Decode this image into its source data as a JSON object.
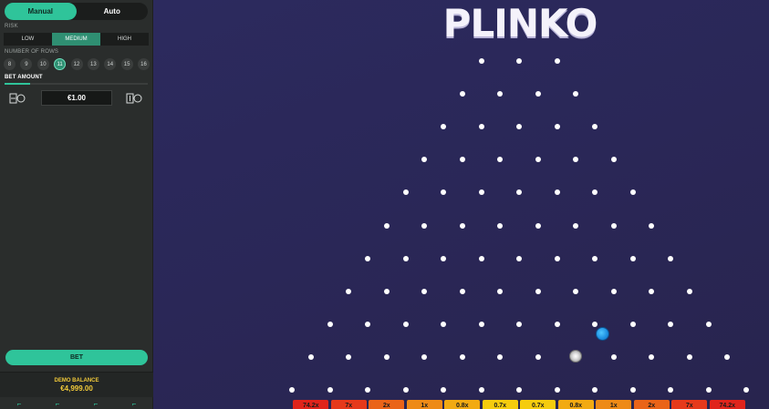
{
  "game": {
    "title": "PLINKO"
  },
  "panel": {
    "modes": {
      "manual": "Manual",
      "auto": "Auto"
    },
    "risk": {
      "label": "RISK",
      "options": [
        "LOW",
        "MEDIUM",
        "HIGH"
      ],
      "selected": "MEDIUM"
    },
    "rows": {
      "label": "NUMBER OF ROWS",
      "options": [
        "8",
        "9",
        "10",
        "11",
        "12",
        "13",
        "14",
        "15",
        "16"
      ],
      "selected": "11"
    },
    "bet": {
      "label": "BET AMOUNT",
      "amount": "€1.00",
      "decrease_icon": "coin-minus-icon",
      "increase_icon": "coin-plus-icon"
    },
    "bet_button": "BET",
    "balance": {
      "label": "DEMO BALANCE",
      "value": "€4,999.00"
    }
  },
  "buckets": [
    {
      "label": "74.2x",
      "color": "#e0241b"
    },
    {
      "label": "7x",
      "color": "#e6391a"
    },
    {
      "label": "2x",
      "color": "#ea6418"
    },
    {
      "label": "1x",
      "color": "#ee8a16"
    },
    {
      "label": "0.8x",
      "color": "#f2aa12"
    },
    {
      "label": "0.7x",
      "color": "#f5cc0e"
    },
    {
      "label": "0.7x",
      "color": "#f5cc0e"
    },
    {
      "label": "0.8x",
      "color": "#f2aa12"
    },
    {
      "label": "1x",
      "color": "#ee8a16"
    },
    {
      "label": "2x",
      "color": "#ea6418"
    },
    {
      "label": "7x",
      "color": "#e6391a"
    },
    {
      "label": "74.2x",
      "color": "#e0241b"
    }
  ]
}
